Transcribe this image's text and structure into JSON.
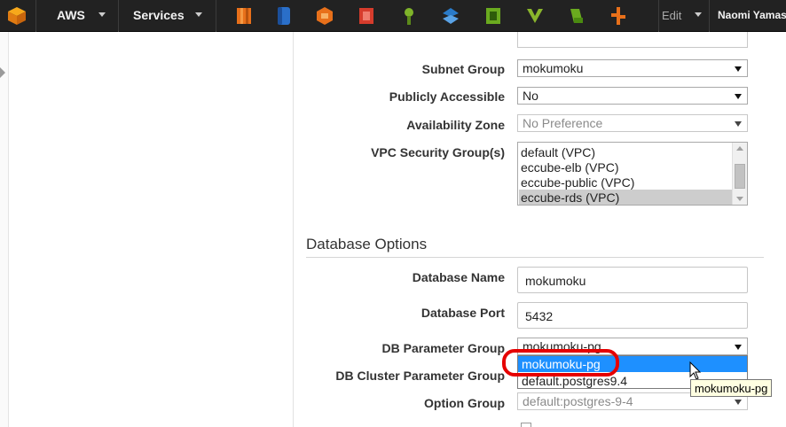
{
  "topbar": {
    "aws_label": "AWS",
    "services_label": "Services",
    "edit_label": "Edit",
    "user_name": "Naomi Yamas",
    "service_icons": [
      {
        "name": "ec2-icon",
        "color": "#e8701a"
      },
      {
        "name": "s3-icon",
        "color": "#2a6fc9"
      },
      {
        "name": "cloudfront-icon",
        "color": "#e8701a"
      },
      {
        "name": "elasticache-icon",
        "color": "#d63c2c"
      },
      {
        "name": "iam-icon",
        "color": "#7fb42a"
      },
      {
        "name": "cloudformation-icon",
        "color": "#2a7bc9"
      },
      {
        "name": "opsworks-icon",
        "color": "#6aaa1f"
      },
      {
        "name": "vpc-icon",
        "color": "#8ab52c"
      },
      {
        "name": "deploy-icon",
        "color": "#6aaa1f"
      },
      {
        "name": "lambda-icon",
        "color": "#e8701a"
      }
    ]
  },
  "form": {
    "subnet_group": {
      "label": "Subnet Group",
      "value": "mokumoku"
    },
    "publicly_accessible": {
      "label": "Publicly Accessible",
      "value": "No"
    },
    "availability_zone": {
      "label": "Availability Zone",
      "value": "No Preference"
    },
    "vpc_security_groups": {
      "label": "VPC Security Group(s)",
      "options": [
        "default (VPC)",
        "eccube-elb (VPC)",
        "eccube-public (VPC)",
        "eccube-rds (VPC)"
      ],
      "selected": "eccube-rds (VPC)"
    }
  },
  "database_options": {
    "title": "Database Options",
    "database_name": {
      "label": "Database Name",
      "value": "mokumoku"
    },
    "database_port": {
      "label": "Database Port",
      "value": "5432"
    },
    "db_parameter_group": {
      "label": "DB Parameter Group",
      "value": "mokumoku-pg",
      "options": [
        "mokumoku-pg",
        "default.postgres9.4"
      ],
      "highlighted": "mokumoku-pg"
    },
    "db_cluster_parameter_group": {
      "label": "DB Cluster Parameter Group"
    },
    "option_group": {
      "label": "Option Group",
      "value": "default:postgres-9-4"
    }
  },
  "tooltip": {
    "text": "mokumoku-pg"
  }
}
